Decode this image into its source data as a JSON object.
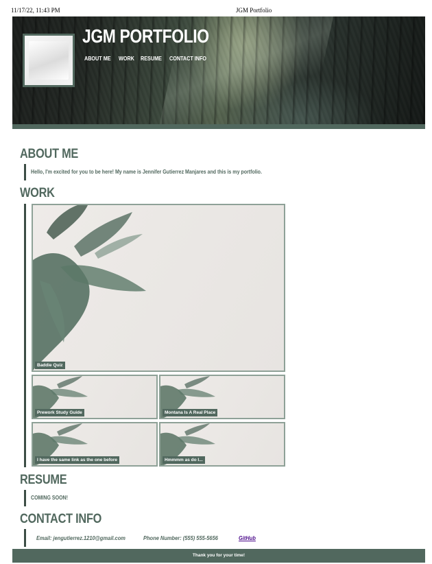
{
  "print_header": {
    "datetime": "11/17/22, 11:43 PM",
    "page_title": "JGM Portfolio"
  },
  "header": {
    "brand": "JGM PORTFOLIO",
    "nav": [
      "ABOUT ME",
      "WORK",
      "RESUME",
      "CONTACT INFO"
    ]
  },
  "about": {
    "title": "ABOUT ME",
    "text": "Hello, I'm excited for you to be here! My name is Jennifer Gutierrez Manjares and this is my portfolio."
  },
  "work": {
    "title": "WORK",
    "projects": [
      {
        "label": "Baddie Quiz"
      },
      {
        "label": "Prework Study Guide"
      },
      {
        "label": "Montana Is A Real Place"
      },
      {
        "label": "I have the same link as the one before"
      },
      {
        "label": "Hmmmm as do I..."
      }
    ]
  },
  "resume": {
    "title": "RESUME",
    "text": "COMING SOON!"
  },
  "contact": {
    "title": "CONTACT INFO",
    "email": "Email: jengutierrez.1210@gmail.com",
    "phone": "Phone Number: (555) 555-5656",
    "github": "GitHub"
  },
  "footer": {
    "text": "Thank you for your time!"
  },
  "colors": {
    "accent": "#51685e",
    "link": "#4b0a8a"
  }
}
